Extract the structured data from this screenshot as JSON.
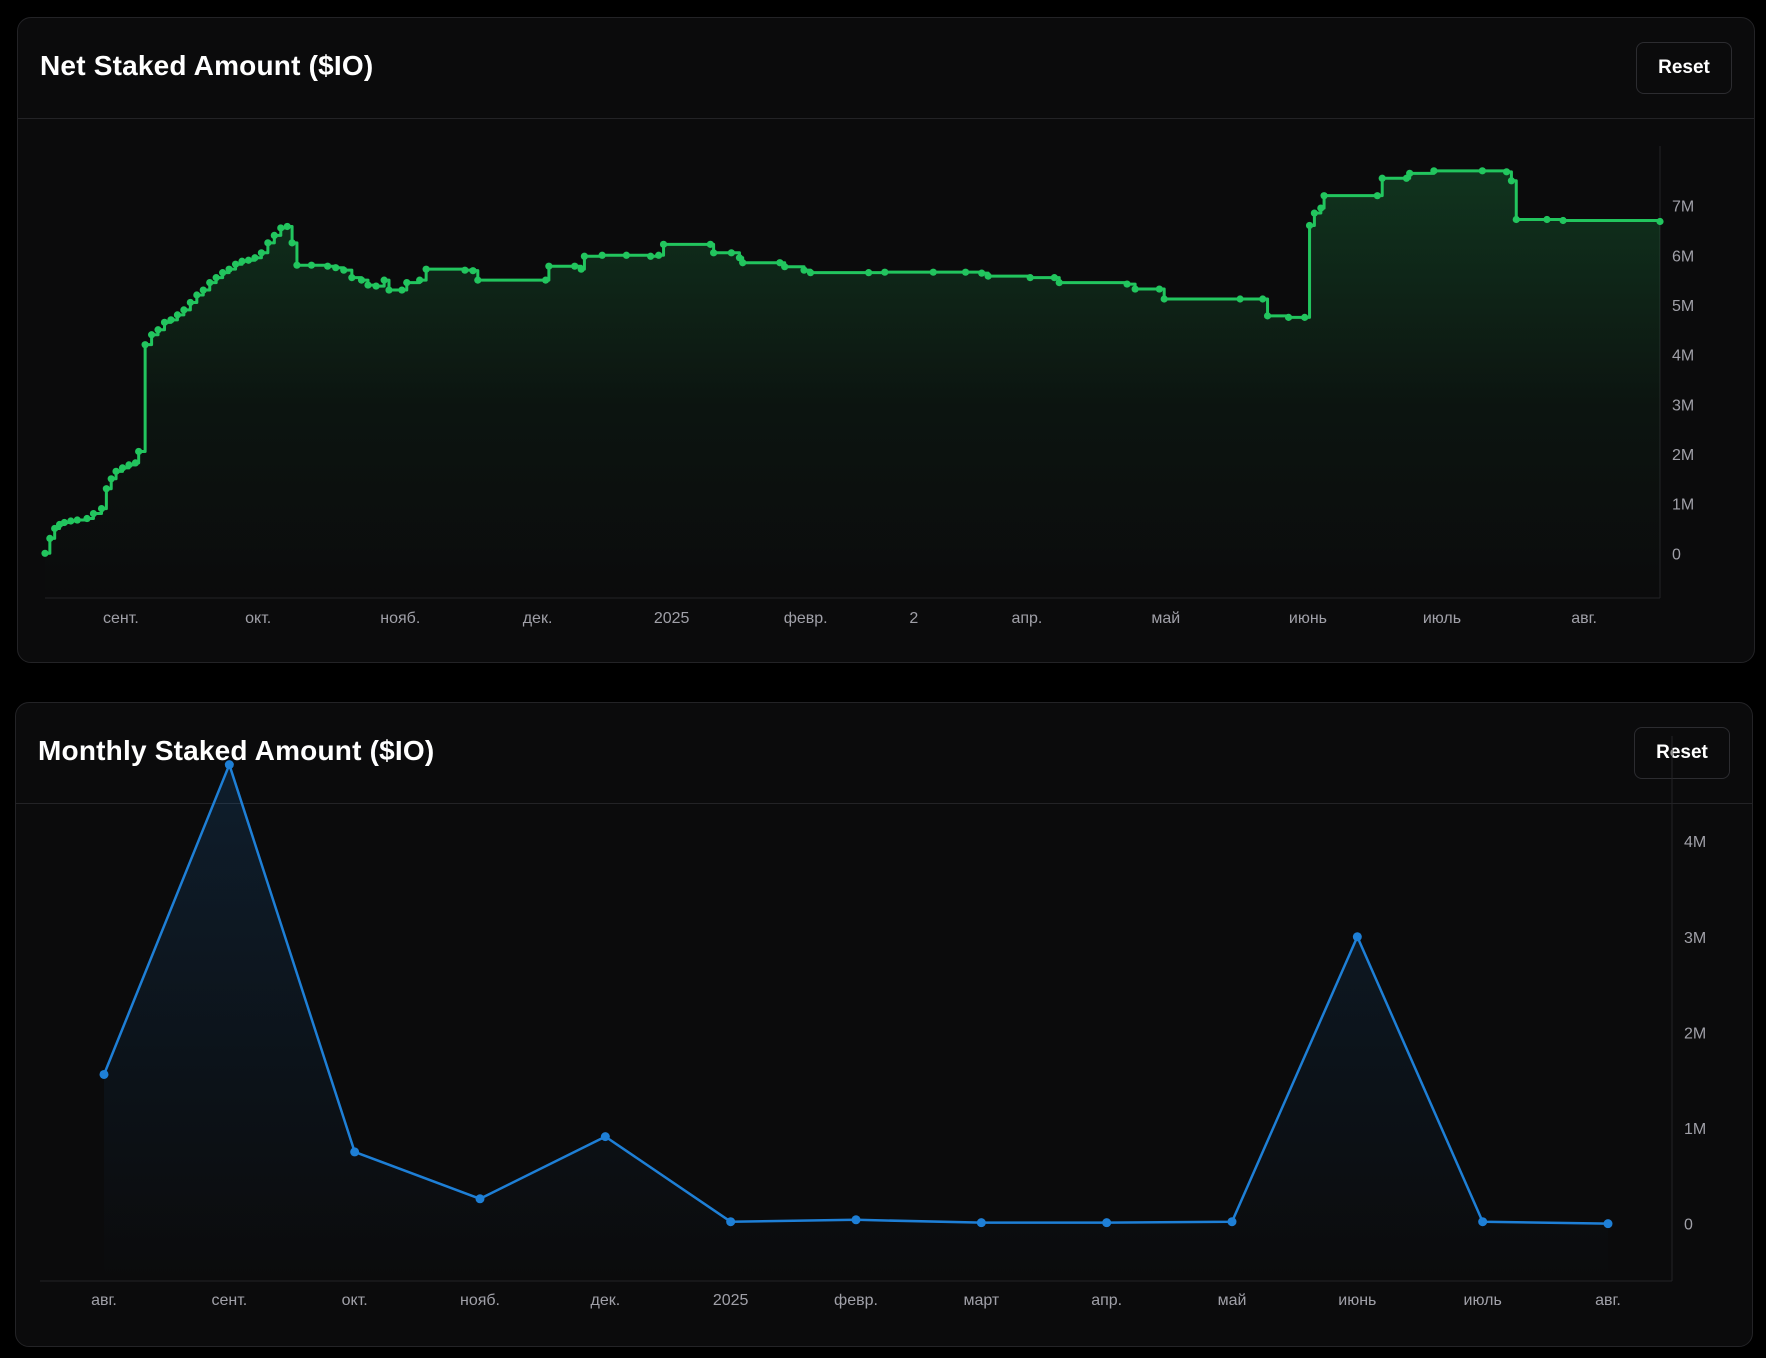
{
  "colors": {
    "background": "#000000",
    "card": "#0b0b0c",
    "border": "#232326",
    "net_line": "#22c55e",
    "monthly_line": "#1e7fd6",
    "tick_text": "#a0a0a8"
  },
  "icons": [],
  "chart_data": [
    {
      "id": "net",
      "type": "area",
      "title": "Net Staked Amount ($IO)",
      "reset_label": "Reset",
      "grid": false,
      "legend": "none",
      "color": "#22c55e",
      "xlabel": "",
      "ylabel": "",
      "x_range": [
        0,
        1
      ],
      "ylim": [
        -0.9,
        8.2
      ],
      "y_axis_position": "right",
      "y_ticks": [
        {
          "value": 0,
          "label": "0"
        },
        {
          "value": 1,
          "label": "1M"
        },
        {
          "value": 2,
          "label": "2M"
        },
        {
          "value": 3,
          "label": "3M"
        },
        {
          "value": 4,
          "label": "4M"
        },
        {
          "value": 5,
          "label": "5M"
        },
        {
          "value": 6,
          "label": "6M"
        },
        {
          "value": 7,
          "label": "7M"
        }
      ],
      "x_ticks": [
        {
          "pos": 0.047,
          "label": "сент."
        },
        {
          "pos": 0.132,
          "label": "окт."
        },
        {
          "pos": 0.22,
          "label": "нояб."
        },
        {
          "pos": 0.305,
          "label": "дек."
        },
        {
          "pos": 0.388,
          "label": "2025"
        },
        {
          "pos": 0.471,
          "label": "февр."
        },
        {
          "pos": 0.538,
          "label": "2"
        },
        {
          "pos": 0.608,
          "label": "апр."
        },
        {
          "pos": 0.694,
          "label": "май"
        },
        {
          "pos": 0.782,
          "label": "июнь"
        },
        {
          "pos": 0.865,
          "label": "июль"
        },
        {
          "pos": 0.953,
          "label": "авг."
        }
      ],
      "step": true,
      "points": [
        [
          0.0,
          0.0
        ],
        [
          0.003,
          0.3
        ],
        [
          0.006,
          0.5
        ],
        [
          0.009,
          0.58
        ],
        [
          0.012,
          0.62
        ],
        [
          0.016,
          0.65
        ],
        [
          0.02,
          0.67
        ],
        [
          0.026,
          0.7
        ],
        [
          0.03,
          0.8
        ],
        [
          0.035,
          0.9
        ],
        [
          0.038,
          1.3
        ],
        [
          0.041,
          1.5
        ],
        [
          0.044,
          1.65
        ],
        [
          0.048,
          1.72
        ],
        [
          0.052,
          1.78
        ],
        [
          0.056,
          1.82
        ],
        [
          0.058,
          2.05
        ],
        [
          0.062,
          4.2
        ],
        [
          0.066,
          4.4
        ],
        [
          0.07,
          4.5
        ],
        [
          0.074,
          4.65
        ],
        [
          0.078,
          4.7
        ],
        [
          0.082,
          4.8
        ],
        [
          0.086,
          4.9
        ],
        [
          0.09,
          5.05
        ],
        [
          0.094,
          5.2
        ],
        [
          0.098,
          5.3
        ],
        [
          0.102,
          5.45
        ],
        [
          0.106,
          5.55
        ],
        [
          0.11,
          5.65
        ],
        [
          0.114,
          5.72
        ],
        [
          0.118,
          5.82
        ],
        [
          0.122,
          5.88
        ],
        [
          0.126,
          5.9
        ],
        [
          0.13,
          5.95
        ],
        [
          0.134,
          6.05
        ],
        [
          0.138,
          6.25
        ],
        [
          0.142,
          6.4
        ],
        [
          0.146,
          6.55
        ],
        [
          0.15,
          6.58
        ],
        [
          0.153,
          6.25
        ],
        [
          0.156,
          5.8
        ],
        [
          0.165,
          5.8
        ],
        [
          0.175,
          5.78
        ],
        [
          0.18,
          5.75
        ],
        [
          0.185,
          5.7
        ],
        [
          0.19,
          5.55
        ],
        [
          0.196,
          5.5
        ],
        [
          0.2,
          5.4
        ],
        [
          0.205,
          5.38
        ],
        [
          0.21,
          5.5
        ],
        [
          0.213,
          5.3
        ],
        [
          0.221,
          5.3
        ],
        [
          0.224,
          5.45
        ],
        [
          0.232,
          5.5
        ],
        [
          0.236,
          5.72
        ],
        [
          0.26,
          5.7
        ],
        [
          0.265,
          5.69
        ],
        [
          0.268,
          5.5
        ],
        [
          0.31,
          5.5
        ],
        [
          0.312,
          5.78
        ],
        [
          0.328,
          5.78
        ],
        [
          0.332,
          5.72
        ],
        [
          0.334,
          5.98
        ],
        [
          0.345,
          6.0
        ],
        [
          0.36,
          6.0
        ],
        [
          0.375,
          5.98
        ],
        [
          0.38,
          6.0
        ],
        [
          0.383,
          6.22
        ],
        [
          0.412,
          6.22
        ],
        [
          0.414,
          6.05
        ],
        [
          0.425,
          6.05
        ],
        [
          0.43,
          5.95
        ],
        [
          0.432,
          5.85
        ],
        [
          0.455,
          5.85
        ],
        [
          0.458,
          5.77
        ],
        [
          0.47,
          5.7
        ],
        [
          0.474,
          5.65
        ],
        [
          0.51,
          5.65
        ],
        [
          0.52,
          5.66
        ],
        [
          0.55,
          5.66
        ],
        [
          0.57,
          5.66
        ],
        [
          0.58,
          5.64
        ],
        [
          0.584,
          5.58
        ],
        [
          0.61,
          5.55
        ],
        [
          0.625,
          5.55
        ],
        [
          0.628,
          5.45
        ],
        [
          0.67,
          5.42
        ],
        [
          0.675,
          5.32
        ],
        [
          0.69,
          5.32
        ],
        [
          0.693,
          5.12
        ],
        [
          0.74,
          5.12
        ],
        [
          0.754,
          5.12
        ],
        [
          0.757,
          4.78
        ],
        [
          0.77,
          4.75
        ],
        [
          0.78,
          4.75
        ],
        [
          0.783,
          6.6
        ],
        [
          0.786,
          6.85
        ],
        [
          0.79,
          6.95
        ],
        [
          0.792,
          7.2
        ],
        [
          0.825,
          7.2
        ],
        [
          0.828,
          7.55
        ],
        [
          0.843,
          7.55
        ],
        [
          0.845,
          7.65
        ],
        [
          0.86,
          7.7
        ],
        [
          0.89,
          7.7
        ],
        [
          0.905,
          7.68
        ],
        [
          0.908,
          7.5
        ],
        [
          0.911,
          6.72
        ],
        [
          0.93,
          6.72
        ],
        [
          0.94,
          6.7
        ],
        [
          1.0,
          6.68
        ]
      ]
    },
    {
      "id": "monthly",
      "type": "area",
      "title": "Monthly Staked Amount ($IO)",
      "reset_label": "Reset",
      "grid": false,
      "legend": "none",
      "color": "#1e7fd6",
      "xlabel": "",
      "ylabel": "",
      "ylim": [
        -0.6,
        5.1
      ],
      "y_axis_position": "right",
      "y_ticks": [
        {
          "value": 0,
          "label": "0"
        },
        {
          "value": 1,
          "label": "1M"
        },
        {
          "value": 2,
          "label": "2M"
        },
        {
          "value": 3,
          "label": "3M"
        },
        {
          "value": 4,
          "label": "4M"
        }
      ],
      "categories": [
        "авг.",
        "сент.",
        "окт.",
        "нояб.",
        "дек.",
        "2025",
        "февр.",
        "март",
        "апр.",
        "май",
        "июнь",
        "июль",
        "авг."
      ],
      "values": [
        1.56,
        4.8,
        0.75,
        0.26,
        0.91,
        0.02,
        0.04,
        0.01,
        0.01,
        0.02,
        3.0,
        0.02,
        0.0
      ]
    }
  ]
}
